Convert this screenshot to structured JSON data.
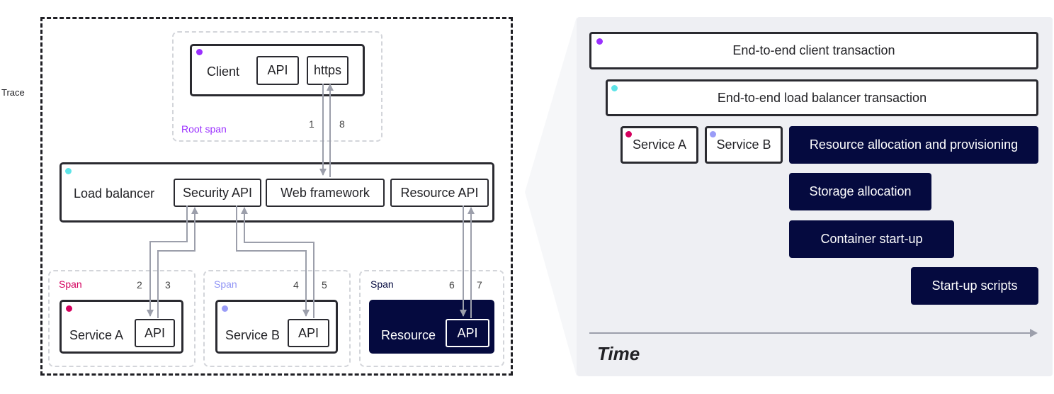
{
  "trace": {
    "label": "Trace",
    "root_span": {
      "label": "Root span",
      "label_color": "#9b30ff",
      "node": {
        "name": "Client",
        "dot_color": "#9b30ff",
        "subs": [
          "API",
          "https"
        ]
      }
    },
    "load_balancer": {
      "name": "Load balancer",
      "dot_color": "#5ee4e8",
      "subs": [
        "Security API",
        "Web framework",
        "Resource API"
      ]
    },
    "spans": [
      {
        "label": "Span",
        "label_color": "#d4005e",
        "node": "Service A",
        "sub": "API",
        "dot_color": "#d4005e",
        "numbers": [
          "2",
          "3"
        ],
        "dark": false
      },
      {
        "label": "Span",
        "label_color": "#8f93f5",
        "node": "Service B",
        "sub": "API",
        "dot_color": "#9a9cf7",
        "numbers": [
          "4",
          "5"
        ],
        "dark": false
      },
      {
        "label": "Span",
        "label_color": "#050a3f",
        "node": "Resource",
        "sub": "API",
        "dot_color": null,
        "numbers": [
          "6",
          "7"
        ],
        "dark": true
      }
    ],
    "client_numbers": [
      "1",
      "8"
    ],
    "arrow_color": "#9c9fab"
  },
  "timeline": {
    "axis_label": "Time",
    "bars": [
      {
        "label": "End-to-end client transaction",
        "style": "light",
        "dot_color": "#9b30ff"
      },
      {
        "label": "End-to-end load balancer transaction",
        "style": "light",
        "dot_color": "#5ee4e8"
      },
      {
        "label": "Service A",
        "style": "light",
        "dot_color": "#d4005e"
      },
      {
        "label": "Service B",
        "style": "light",
        "dot_color": "#9a9cf7"
      },
      {
        "label": "Resource allocation and provisioning",
        "style": "dark",
        "dot_color": null
      },
      {
        "label": "Storage allocation",
        "style": "dark",
        "dot_color": null
      },
      {
        "label": "Container start-up",
        "style": "dark",
        "dot_color": null
      },
      {
        "label": "Start-up scripts",
        "style": "dark",
        "dot_color": null
      }
    ]
  },
  "colors": {
    "dark_navy": "#050a3f",
    "panel_bg": "#eeeff3",
    "border": "#2a2a30"
  }
}
